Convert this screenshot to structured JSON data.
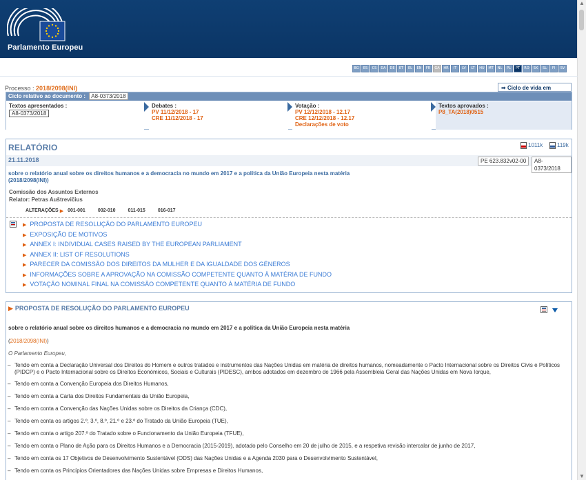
{
  "header": {
    "logo_text": "Parlamento Europeu"
  },
  "languages": [
    "BG",
    "ES",
    "CS",
    "DA",
    "DE",
    "ET",
    "EL",
    "EN",
    "FR",
    "GA",
    "HR",
    "IT",
    "LV",
    "LT",
    "HU",
    "MT",
    "NL",
    "PL",
    "PT",
    "RO",
    "SK",
    "SL",
    "FI",
    "SV"
  ],
  "lang_disabled": "GA",
  "lang_active": "PT",
  "processo": {
    "label": "Processo :",
    "value": "2018/2098(INI)"
  },
  "ciclo_button": "Ciclo de vida em sessão",
  "cycle": {
    "head_label": "Ciclo relativo ao documento :",
    "head_doc": "A8-0373/2018",
    "stages": [
      {
        "title": "Textos apresentados :",
        "lines": [
          "A8-0373/2018"
        ]
      },
      {
        "title": "Debates :",
        "lines": [
          "PV 11/12/2018 - 17",
          "CRE 11/12/2018 - 17"
        ]
      },
      {
        "title": "Votação :",
        "lines": [
          "PV 12/12/2018 - 12.17",
          "CRE 12/12/2018 - 12.17",
          "Declarações de voto"
        ]
      },
      {
        "title": "Textos aprovados :",
        "lines": [
          "P8_TA(2018)0515"
        ]
      }
    ]
  },
  "report": {
    "title": "RELATÓRIO",
    "pdf_size": "1011k",
    "doc_size": "119k",
    "date": "21.11.2018",
    "ref1": "PE 623.832v02-00",
    "ref2": "A8-0373/2018",
    "subject": "sobre o relatório anual sobre os direitos humanos e a democracia no mundo em 2017 e a política da União Europeia nesta matéria",
    "subject_proc": "(2018/2098(INI))",
    "committee": "Comissão dos Assuntos Externos",
    "rapporteur": "Relator: Petras Auštrevičius",
    "amend_label": "ALTERAÇÕES",
    "amendments": [
      "001-001",
      "002-010",
      "011-015",
      "016-017"
    ],
    "toc": [
      "PROPOSTA DE RESOLUÇÃO DO PARLAMENTO EUROPEU",
      "EXPOSIÇÃO DE MOTIVOS",
      "ANNEX I: INDIVIDUAL CASES RAISED BY THE EUROPEAN PARLIAMENT",
      "ANNEX II: LIST OF RESOLUTIONS",
      "PARECER DA COMISSÃO DOS DIREITOS DA MULHER E DA IGUALDADE DOS GÉNEROS",
      "INFORMAÇÕES SOBRE A APROVAÇÃO NA COMISSÃO COMPETENTE QUANTO À MATÉRIA DE FUNDO",
      "VOTAÇÃO NOMINAL FINAL NA COMISSÃO COMPETENTE QUANTO À MATÉRIA DE FUNDO"
    ]
  },
  "body": {
    "title": "PROPOSTA DE RESOLUÇÃO DO PARLAMENTO EUROPEU",
    "subject": "sobre o relatório anual sobre os direitos humanos e a democracia no mundo em 2017 e a política da União Europeia nesta matéria",
    "proc_open": "(",
    "proc": "2018/2098(INI)",
    "proc_close": ")",
    "ep": "O Parlamento Europeu,",
    "dash": "–",
    "paragraphs": [
      "Tendo em conta a Declaração Universal dos Direitos do Homem e outros tratados e instrumentos das Nações Unidas em matéria de direitos humanos, nomeadamente o Pacto Internacional sobre os Direitos Civis e Políticos (PIDCP) e o Pacto Internacional sobre os Direitos Económicos, Sociais e Culturais (PIDESC), ambos adotados em dezembro de 1966 pela Assembleia Geral das Nações Unidas em Nova Iorque,",
      "Tendo em conta a Convenção Europeia dos Direitos Humanos,",
      "Tendo em conta a Carta dos Direitos Fundamentais da União Europeia,",
      "Tendo em conta a Convenção das Nações Unidas sobre os Direitos da Criança (CDC),",
      "Tendo em conta os artigos 2.º, 3.º, 8.º, 21.º e 23.º do Tratado da União Europeia (TUE),",
      "Tendo em conta o artigo 207.º do Tratado sobre o Funcionamento da União Europeia (TFUE),",
      "Tendo em conta o Plano de Ação para os Direitos Humanos e a Democracia (2015-2019), adotado pelo Conselho em 20 de julho de 2015, e a respetiva revisão intercalar de junho de 2017,",
      "Tendo em conta os 17 Objetivos de Desenvolvimento Sustentável (ODS) das Nações Unidas e a Agenda 2030 para o Desenvolvimento Sustentável,",
      "Tendo em conta os Princípios Orientadores das Nações Unidas sobre Empresas e Direitos Humanos,"
    ]
  },
  "colors": {
    "header": "#0f3f73",
    "accent_orange": "#e06010",
    "link_blue": "#3a7bd5",
    "title_blue": "#587ca8"
  }
}
